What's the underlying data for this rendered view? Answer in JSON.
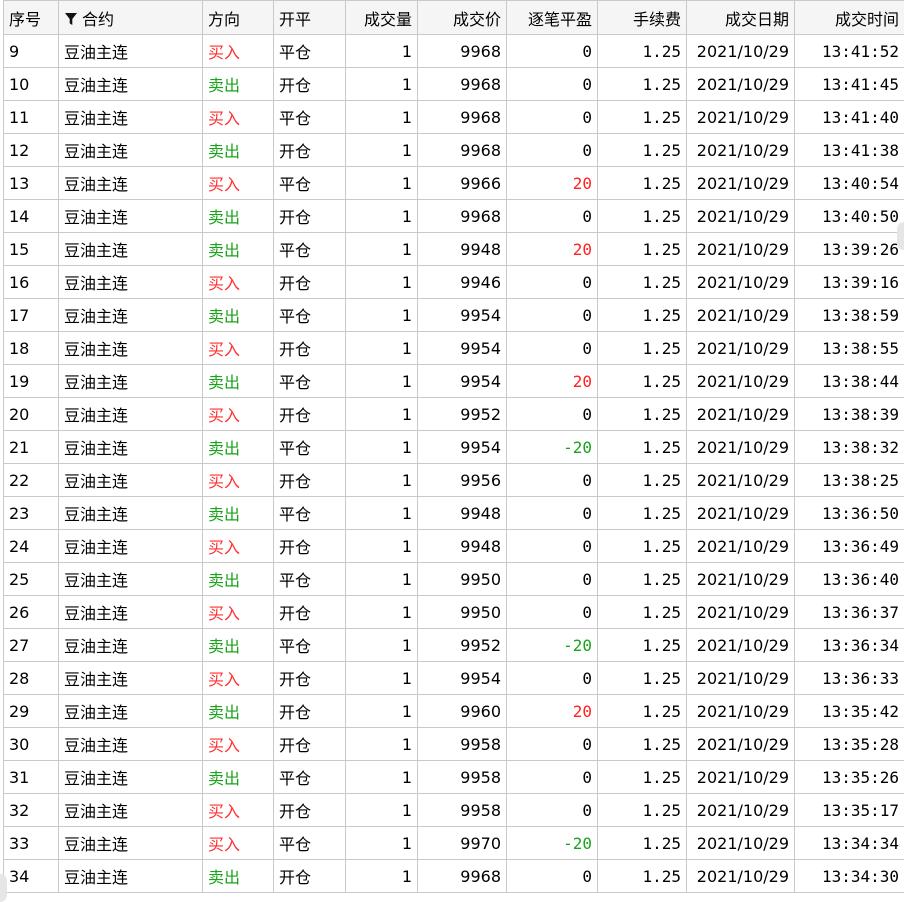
{
  "columns": {
    "seq": "序号",
    "contract": "合约",
    "direction": "方向",
    "openclose": "开平",
    "qty": "成交量",
    "price": "成交价",
    "pnl": "逐笔平盈",
    "fee": "手续费",
    "date": "成交日期",
    "time": "成交时间"
  },
  "icons": {
    "filter": "filter-icon"
  },
  "colors": {
    "buy": "#ff3030",
    "sell": "#1aa31a",
    "profit": "#ff2020",
    "loss": "#1aa31a"
  },
  "rows": [
    {
      "seq": "9",
      "contract": "豆油主连",
      "direction": "买入",
      "openclose": "平仓",
      "qty": "1",
      "price": "9968",
      "pnl": "0",
      "fee": "1.25",
      "date": "2021/10/29",
      "time": "13:41:52"
    },
    {
      "seq": "10",
      "contract": "豆油主连",
      "direction": "卖出",
      "openclose": "开仓",
      "qty": "1",
      "price": "9968",
      "pnl": "0",
      "fee": "1.25",
      "date": "2021/10/29",
      "time": "13:41:45"
    },
    {
      "seq": "11",
      "contract": "豆油主连",
      "direction": "买入",
      "openclose": "平仓",
      "qty": "1",
      "price": "9968",
      "pnl": "0",
      "fee": "1.25",
      "date": "2021/10/29",
      "time": "13:41:40"
    },
    {
      "seq": "12",
      "contract": "豆油主连",
      "direction": "卖出",
      "openclose": "开仓",
      "qty": "1",
      "price": "9968",
      "pnl": "0",
      "fee": "1.25",
      "date": "2021/10/29",
      "time": "13:41:38"
    },
    {
      "seq": "13",
      "contract": "豆油主连",
      "direction": "买入",
      "openclose": "平仓",
      "qty": "1",
      "price": "9966",
      "pnl": "20",
      "fee": "1.25",
      "date": "2021/10/29",
      "time": "13:40:54"
    },
    {
      "seq": "14",
      "contract": "豆油主连",
      "direction": "卖出",
      "openclose": "开仓",
      "qty": "1",
      "price": "9968",
      "pnl": "0",
      "fee": "1.25",
      "date": "2021/10/29",
      "time": "13:40:50"
    },
    {
      "seq": "15",
      "contract": "豆油主连",
      "direction": "卖出",
      "openclose": "平仓",
      "qty": "1",
      "price": "9948",
      "pnl": "20",
      "fee": "1.25",
      "date": "2021/10/29",
      "time": "13:39:26"
    },
    {
      "seq": "16",
      "contract": "豆油主连",
      "direction": "买入",
      "openclose": "开仓",
      "qty": "1",
      "price": "9946",
      "pnl": "0",
      "fee": "1.25",
      "date": "2021/10/29",
      "time": "13:39:16"
    },
    {
      "seq": "17",
      "contract": "豆油主连",
      "direction": "卖出",
      "openclose": "平仓",
      "qty": "1",
      "price": "9954",
      "pnl": "0",
      "fee": "1.25",
      "date": "2021/10/29",
      "time": "13:38:59"
    },
    {
      "seq": "18",
      "contract": "豆油主连",
      "direction": "买入",
      "openclose": "开仓",
      "qty": "1",
      "price": "9954",
      "pnl": "0",
      "fee": "1.25",
      "date": "2021/10/29",
      "time": "13:38:55"
    },
    {
      "seq": "19",
      "contract": "豆油主连",
      "direction": "卖出",
      "openclose": "平仓",
      "qty": "1",
      "price": "9954",
      "pnl": "20",
      "fee": "1.25",
      "date": "2021/10/29",
      "time": "13:38:44"
    },
    {
      "seq": "20",
      "contract": "豆油主连",
      "direction": "买入",
      "openclose": "开仓",
      "qty": "1",
      "price": "9952",
      "pnl": "0",
      "fee": "1.25",
      "date": "2021/10/29",
      "time": "13:38:39"
    },
    {
      "seq": "21",
      "contract": "豆油主连",
      "direction": "卖出",
      "openclose": "平仓",
      "qty": "1",
      "price": "9954",
      "pnl": "-20",
      "fee": "1.25",
      "date": "2021/10/29",
      "time": "13:38:32"
    },
    {
      "seq": "22",
      "contract": "豆油主连",
      "direction": "买入",
      "openclose": "开仓",
      "qty": "1",
      "price": "9956",
      "pnl": "0",
      "fee": "1.25",
      "date": "2021/10/29",
      "time": "13:38:25"
    },
    {
      "seq": "23",
      "contract": "豆油主连",
      "direction": "卖出",
      "openclose": "平仓",
      "qty": "1",
      "price": "9948",
      "pnl": "0",
      "fee": "1.25",
      "date": "2021/10/29",
      "time": "13:36:50"
    },
    {
      "seq": "24",
      "contract": "豆油主连",
      "direction": "买入",
      "openclose": "开仓",
      "qty": "1",
      "price": "9948",
      "pnl": "0",
      "fee": "1.25",
      "date": "2021/10/29",
      "time": "13:36:49"
    },
    {
      "seq": "25",
      "contract": "豆油主连",
      "direction": "卖出",
      "openclose": "平仓",
      "qty": "1",
      "price": "9950",
      "pnl": "0",
      "fee": "1.25",
      "date": "2021/10/29",
      "time": "13:36:40"
    },
    {
      "seq": "26",
      "contract": "豆油主连",
      "direction": "买入",
      "openclose": "开仓",
      "qty": "1",
      "price": "9950",
      "pnl": "0",
      "fee": "1.25",
      "date": "2021/10/29",
      "time": "13:36:37"
    },
    {
      "seq": "27",
      "contract": "豆油主连",
      "direction": "卖出",
      "openclose": "平仓",
      "qty": "1",
      "price": "9952",
      "pnl": "-20",
      "fee": "1.25",
      "date": "2021/10/29",
      "time": "13:36:34"
    },
    {
      "seq": "28",
      "contract": "豆油主连",
      "direction": "买入",
      "openclose": "开仓",
      "qty": "1",
      "price": "9954",
      "pnl": "0",
      "fee": "1.25",
      "date": "2021/10/29",
      "time": "13:36:33"
    },
    {
      "seq": "29",
      "contract": "豆油主连",
      "direction": "卖出",
      "openclose": "开仓",
      "qty": "1",
      "price": "9960",
      "pnl": "20",
      "fee": "1.25",
      "date": "2021/10/29",
      "time": "13:35:42"
    },
    {
      "seq": "30",
      "contract": "豆油主连",
      "direction": "买入",
      "openclose": "开仓",
      "qty": "1",
      "price": "9958",
      "pnl": "0",
      "fee": "1.25",
      "date": "2021/10/29",
      "time": "13:35:28"
    },
    {
      "seq": "31",
      "contract": "豆油主连",
      "direction": "卖出",
      "openclose": "平仓",
      "qty": "1",
      "price": "9958",
      "pnl": "0",
      "fee": "1.25",
      "date": "2021/10/29",
      "time": "13:35:26"
    },
    {
      "seq": "32",
      "contract": "豆油主连",
      "direction": "买入",
      "openclose": "开仓",
      "qty": "1",
      "price": "9958",
      "pnl": "0",
      "fee": "1.25",
      "date": "2021/10/29",
      "time": "13:35:17"
    },
    {
      "seq": "33",
      "contract": "豆油主连",
      "direction": "买入",
      "openclose": "平仓",
      "qty": "1",
      "price": "9970",
      "pnl": "-20",
      "fee": "1.25",
      "date": "2021/10/29",
      "time": "13:34:34"
    },
    {
      "seq": "34",
      "contract": "豆油主连",
      "direction": "卖出",
      "openclose": "开仓",
      "qty": "1",
      "price": "9968",
      "pnl": "0",
      "fee": "1.25",
      "date": "2021/10/29",
      "time": "13:34:30"
    }
  ]
}
